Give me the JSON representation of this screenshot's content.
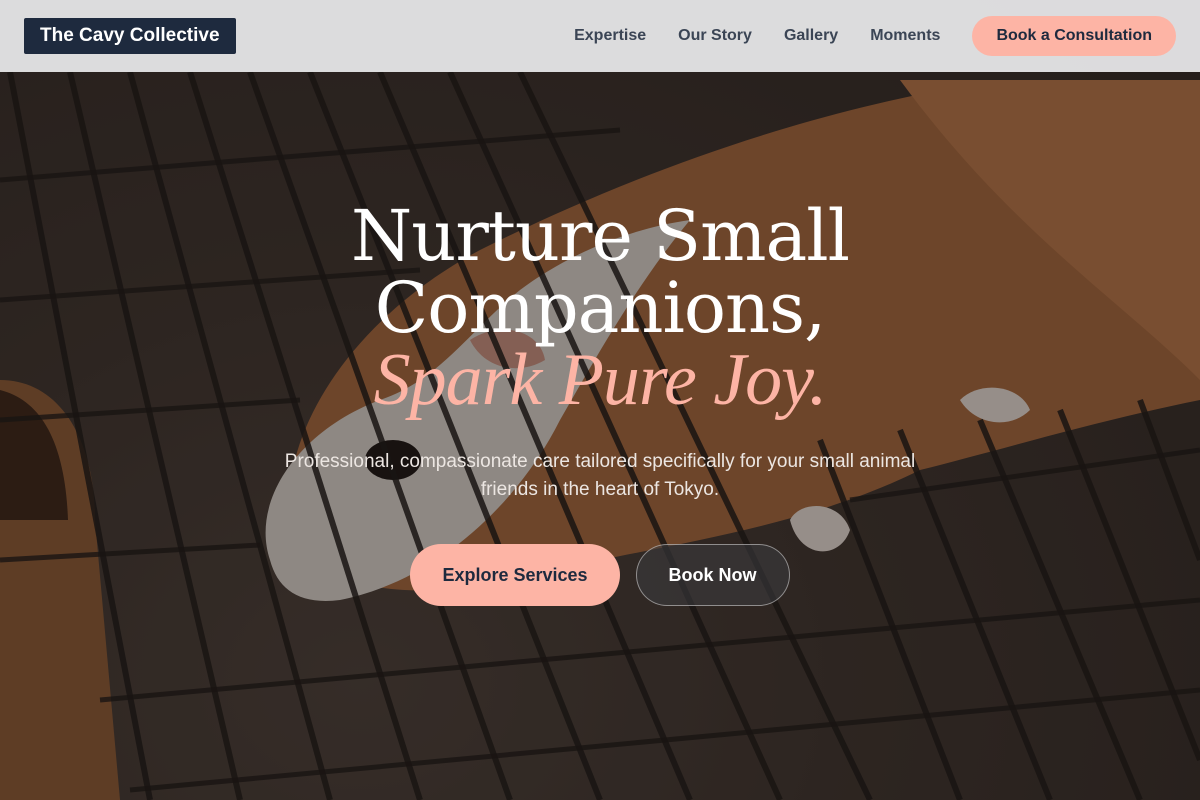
{
  "header": {
    "logo_text": "The Cavy Collective",
    "nav": [
      {
        "label": "Expertise"
      },
      {
        "label": "Our Story"
      },
      {
        "label": "Gallery"
      },
      {
        "label": "Moments"
      }
    ],
    "cta_label": "Book a Consultation"
  },
  "hero": {
    "headline_line1": "Nurture Small",
    "headline_line2": "Companions,",
    "headline_accent": "Spark Pure Joy.",
    "subtext": "Professional, compassionate care tailored specifically for your small animal friends in the heart of Tokyo.",
    "primary_cta": "Explore Services",
    "secondary_cta": "Book Now",
    "background_image": "guinea-pig-on-wire-grid-photo"
  },
  "colors": {
    "accent": "#fdb4a5",
    "navy": "#1e2a3e",
    "header_bg": "#e8e8ea"
  }
}
